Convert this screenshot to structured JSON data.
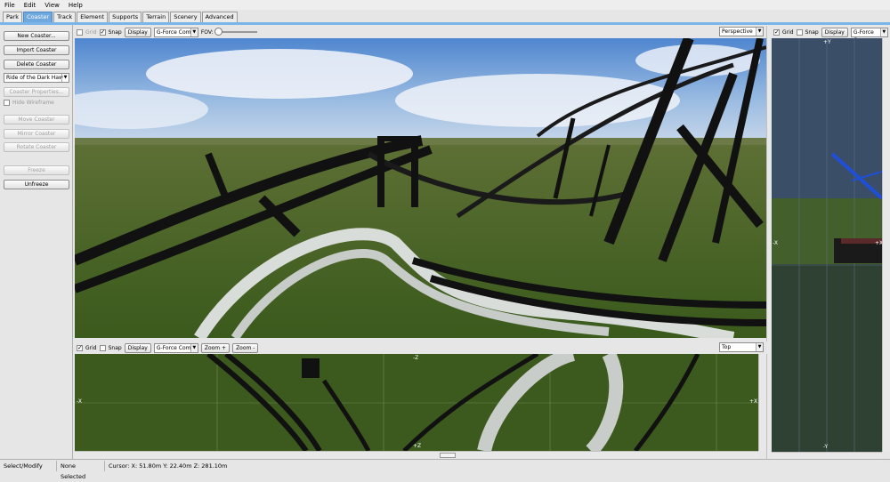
{
  "menu": [
    "File",
    "Edit",
    "View",
    "Help"
  ],
  "tabs": [
    {
      "label": "Park",
      "active": false
    },
    {
      "label": "Coaster",
      "active": true
    },
    {
      "label": "Track",
      "active": false
    },
    {
      "label": "Element",
      "active": false
    },
    {
      "label": "Supports",
      "active": false
    },
    {
      "label": "Terrain",
      "active": false
    },
    {
      "label": "Scenery",
      "active": false
    },
    {
      "label": "Advanced",
      "active": false
    }
  ],
  "left": {
    "new_coaster": "New Coaster...",
    "import_coaster": "Import Coaster",
    "delete_coaster": "Delete Coaster",
    "coaster_select": "Ride of the Dark Haw",
    "coaster_properties": "Coaster Properties...",
    "hide_wireframe": "Hide Wireframe",
    "move_coaster": "Move Coaster",
    "mirror_coaster": "Mirror Coaster",
    "rotate_coaster": "Rotate Coaster",
    "freeze": "Freeze",
    "unfreeze": "Unfreeze"
  },
  "main_view": {
    "grid": "Grid",
    "grid_checked": false,
    "snap": "Snap",
    "snap_checked": true,
    "display": "Display",
    "gforce": "G-Force Com",
    "fov": "FOV:",
    "fov_level": 0.0,
    "projection": "Perspective"
  },
  "bottom_view": {
    "grid": "Grid",
    "grid_checked": true,
    "snap": "Snap",
    "snap_checked": false,
    "display": "Display",
    "gforce": "G-Force Com",
    "zoom_in": "Zoom +",
    "zoom_out": "Zoom -",
    "projection": "Top",
    "axis_neg_z": "-Z",
    "axis_pos_z": "+Z",
    "axis_neg_x": "-X",
    "axis_pos_x": "+X"
  },
  "right_view": {
    "grid": "Grid",
    "grid_checked": true,
    "snap": "Snap",
    "snap_checked": false,
    "display": "Display",
    "gforce": "G-Force Com",
    "axis_pos_y": "+Y",
    "axis_neg_y": "-Y",
    "axis_neg_x": "-X",
    "axis_pos_x": "+X"
  },
  "status": {
    "mode": "Select/Modify",
    "selection": "None Selected",
    "cursor": "Cursor:  X: 51.80m  Y: 22.40m  Z: 281.10m"
  },
  "colors": {
    "tab_active": "#6fa8dc",
    "grass": "#3f5a1e",
    "sky": "#6e9fd6",
    "track_black": "#111111",
    "track_white": "#d8dcd8"
  }
}
